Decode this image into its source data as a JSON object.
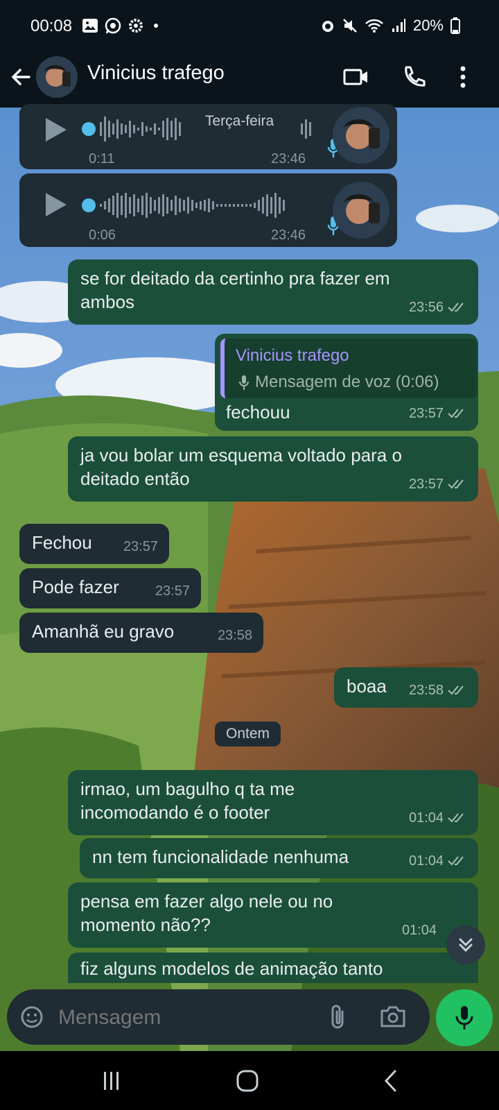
{
  "status_bar": {
    "time": "00:08",
    "battery": "20%"
  },
  "header": {
    "contact_name": "Vinicius trafego"
  },
  "chips": {
    "day1": "Terça-feira",
    "day2": "Ontem"
  },
  "voice_messages": [
    {
      "duration": "0:11",
      "time": "23:46"
    },
    {
      "duration": "0:06",
      "time": "23:46"
    }
  ],
  "messages": [
    {
      "text_line1": "se for deitado da certinho pra fazer em",
      "text_line2": "ambos",
      "time": "23:56"
    },
    {
      "reply_name": "Vinicius trafego",
      "reply_text": "Mensagem de voz (0:06)",
      "text": "fechouu",
      "time": "23:57"
    },
    {
      "text_line1": "ja vou bolar um esquema voltado para o",
      "text_line2": "deitado então",
      "time": "23:57"
    },
    {
      "text": "Fechou",
      "time": "23:57"
    },
    {
      "text": "Pode fazer",
      "time": "23:57"
    },
    {
      "text": "Amanhã eu gravo",
      "time": "23:58"
    },
    {
      "text": "boaa",
      "time": "23:58"
    },
    {
      "text_line1": "irmao, um bagulho q ta me",
      "text_line2": "incomodando é o footer",
      "time": "01:04"
    },
    {
      "text": "nn tem funcionalidade nenhuma",
      "time": "01:04"
    },
    {
      "text_line1": "pensa em fazer algo nele ou no",
      "text_line2": "momento não??",
      "time": "01:04"
    },
    {
      "text": "fiz alguns modelos de animação tanto"
    }
  ],
  "composer": {
    "placeholder": "Mensagem"
  },
  "colors": {
    "outgoing_bubble": "#1b4f3a",
    "incoming_bubble": "#1f2c33",
    "accent_green": "#21c063",
    "background": "#0b141a"
  }
}
